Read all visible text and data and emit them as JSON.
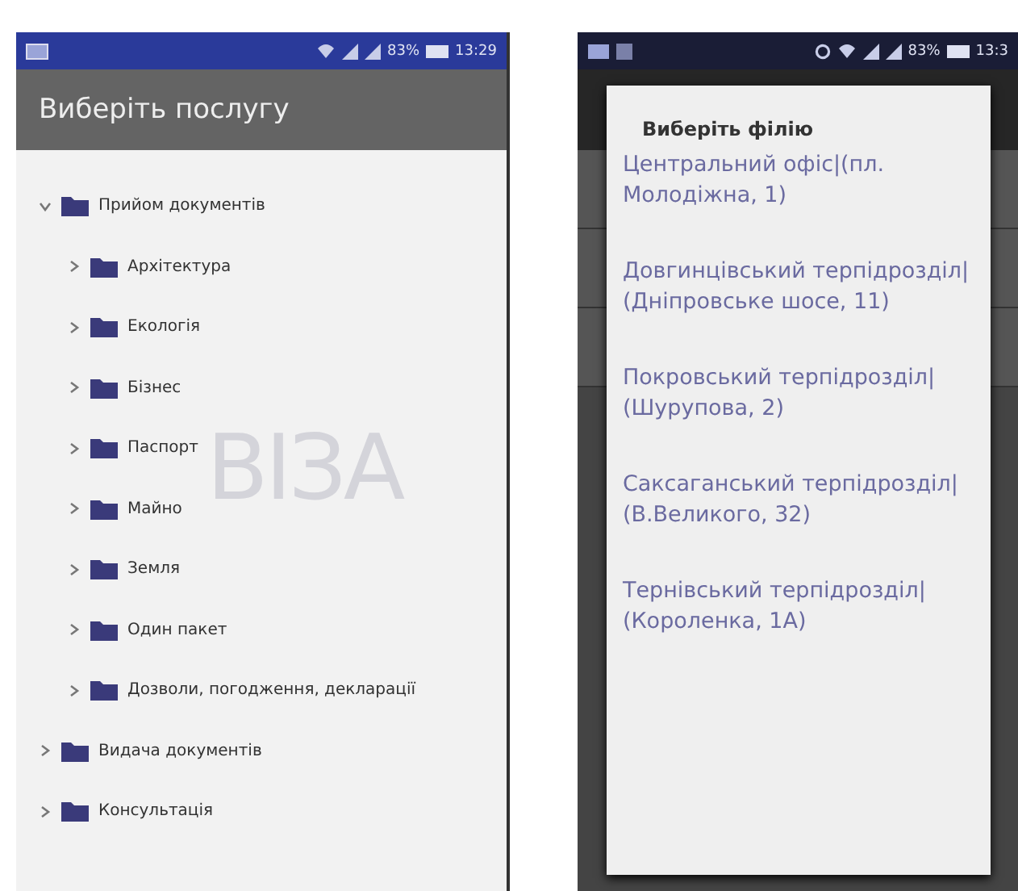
{
  "left_screen": {
    "status_bar": {
      "battery": "83%",
      "time": "13:29"
    },
    "title": "Виберіть послугу",
    "logo": "ВІЗА",
    "tree": [
      {
        "label": "Прийом документів",
        "expanded": true,
        "children": [
          {
            "label": "Архітектура",
            "expanded": false
          },
          {
            "label": "Екологія",
            "expanded": false
          },
          {
            "label": "Бізнес",
            "expanded": false
          },
          {
            "label": "Паспорт",
            "expanded": false
          },
          {
            "label": "Майно",
            "expanded": false
          },
          {
            "label": "Земля",
            "expanded": false
          },
          {
            "label": "Один пакет",
            "expanded": false
          },
          {
            "label": "Дозволи, погодження, декларації",
            "expanded": false
          }
        ]
      },
      {
        "label": "Видача документів",
        "expanded": false
      },
      {
        "label": "Консультація",
        "expanded": false
      }
    ]
  },
  "right_screen": {
    "status_bar": {
      "battery": "83%",
      "time": "13:3"
    },
    "dialog": {
      "title": "Виберіть філію",
      "options": [
        "Центральний офіс|(пл. Молодіжна, 1)",
        "Довгинцівський терпідрозділ|(Дніпровське шосе, 11)",
        "Покровський терпідрозділ|(Шурупова, 2)",
        "Саксаганський терпідрозділ|(В.Великого, 32)",
        "Тернівський терпідрозділ|(Короленка, 1А)"
      ]
    }
  }
}
